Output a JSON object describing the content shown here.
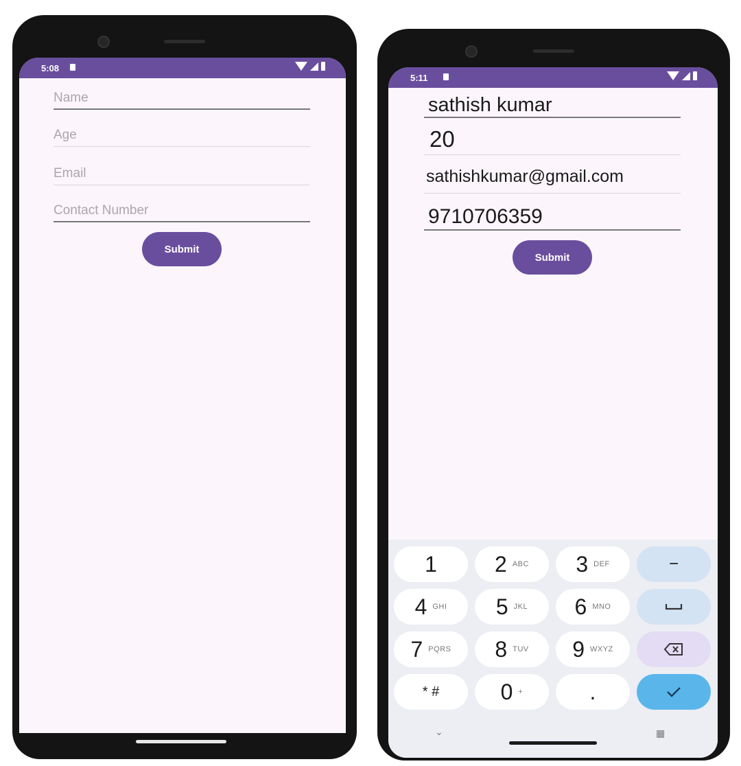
{
  "left_phone": {
    "status_time": "5:08",
    "fields": [
      {
        "placeholder": "Name"
      },
      {
        "placeholder": "Age"
      },
      {
        "placeholder": "Email"
      },
      {
        "placeholder": "Contact Number"
      }
    ],
    "submit_label": "Submit"
  },
  "right_phone": {
    "status_time": "5:11",
    "fields": [
      {
        "value": "sathish kumar"
      },
      {
        "value": "20"
      },
      {
        "value": "sathishkumar@gmail.com"
      },
      {
        "value": "9710706359"
      }
    ],
    "submit_label": "Submit",
    "keyboard": {
      "rows": [
        [
          {
            "digit": "1",
            "sub": ""
          },
          {
            "digit": "2",
            "sub": "ABC"
          },
          {
            "digit": "3",
            "sub": "DEF"
          }
        ],
        [
          {
            "digit": "4",
            "sub": "GHI"
          },
          {
            "digit": "5",
            "sub": "JKL"
          },
          {
            "digit": "6",
            "sub": "MNO"
          }
        ],
        [
          {
            "digit": "7",
            "sub": "PQRS"
          },
          {
            "digit": "8",
            "sub": "TUV"
          },
          {
            "digit": "9",
            "sub": "WXYZ"
          }
        ],
        [
          {
            "digit": "* #",
            "sub": ""
          },
          {
            "digit": "0",
            "sub": "+"
          },
          {
            "digit": ".",
            "sub": ""
          }
        ]
      ],
      "minus_label": "−",
      "space_icon": "space-icon",
      "backspace_icon": "backspace-icon",
      "done_icon": "check-icon"
    }
  },
  "colors": {
    "accent": "#6a4e9e",
    "screen_bg": "#fcf6fc",
    "keyboard_bg": "#eceef4",
    "done_key": "#5ab6ea"
  }
}
